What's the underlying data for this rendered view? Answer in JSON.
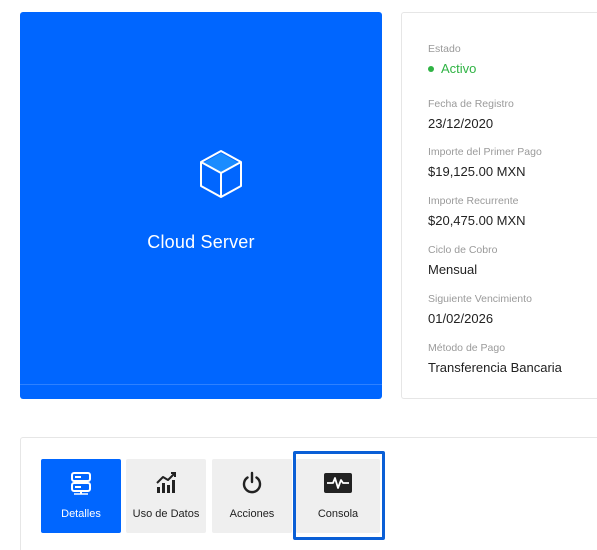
{
  "product": {
    "name": "Cloud Server",
    "icon": "cube-icon",
    "accent_color": "#0066ff"
  },
  "info": {
    "status_label": "Estado",
    "status_value": "Activo",
    "status_color": "#2fb344",
    "registration_label": "Fecha de Registro",
    "registration_value": "23/12/2020",
    "first_payment_label": "Importe del Primer Pago",
    "first_payment_value": "$19,125.00 MXN",
    "recurring_label": "Importe Recurrente",
    "recurring_value": "$20,475.00 MXN",
    "billing_cycle_label": "Ciclo de Cobro",
    "billing_cycle_value": "Mensual",
    "next_due_label": "Siguiente Vencimiento",
    "next_due_value": "01/02/2026",
    "payment_method_label": "Método de Pago",
    "payment_method_value": "Transferencia Bancaria"
  },
  "tabs": [
    {
      "label": "Detalles",
      "icon": "server-icon",
      "active": true
    },
    {
      "label": "Uso de Datos",
      "icon": "chart-icon",
      "active": false
    },
    {
      "label": "Acciones",
      "icon": "power-icon",
      "active": false
    },
    {
      "label": "Consola",
      "icon": "console-icon",
      "active": false
    }
  ]
}
